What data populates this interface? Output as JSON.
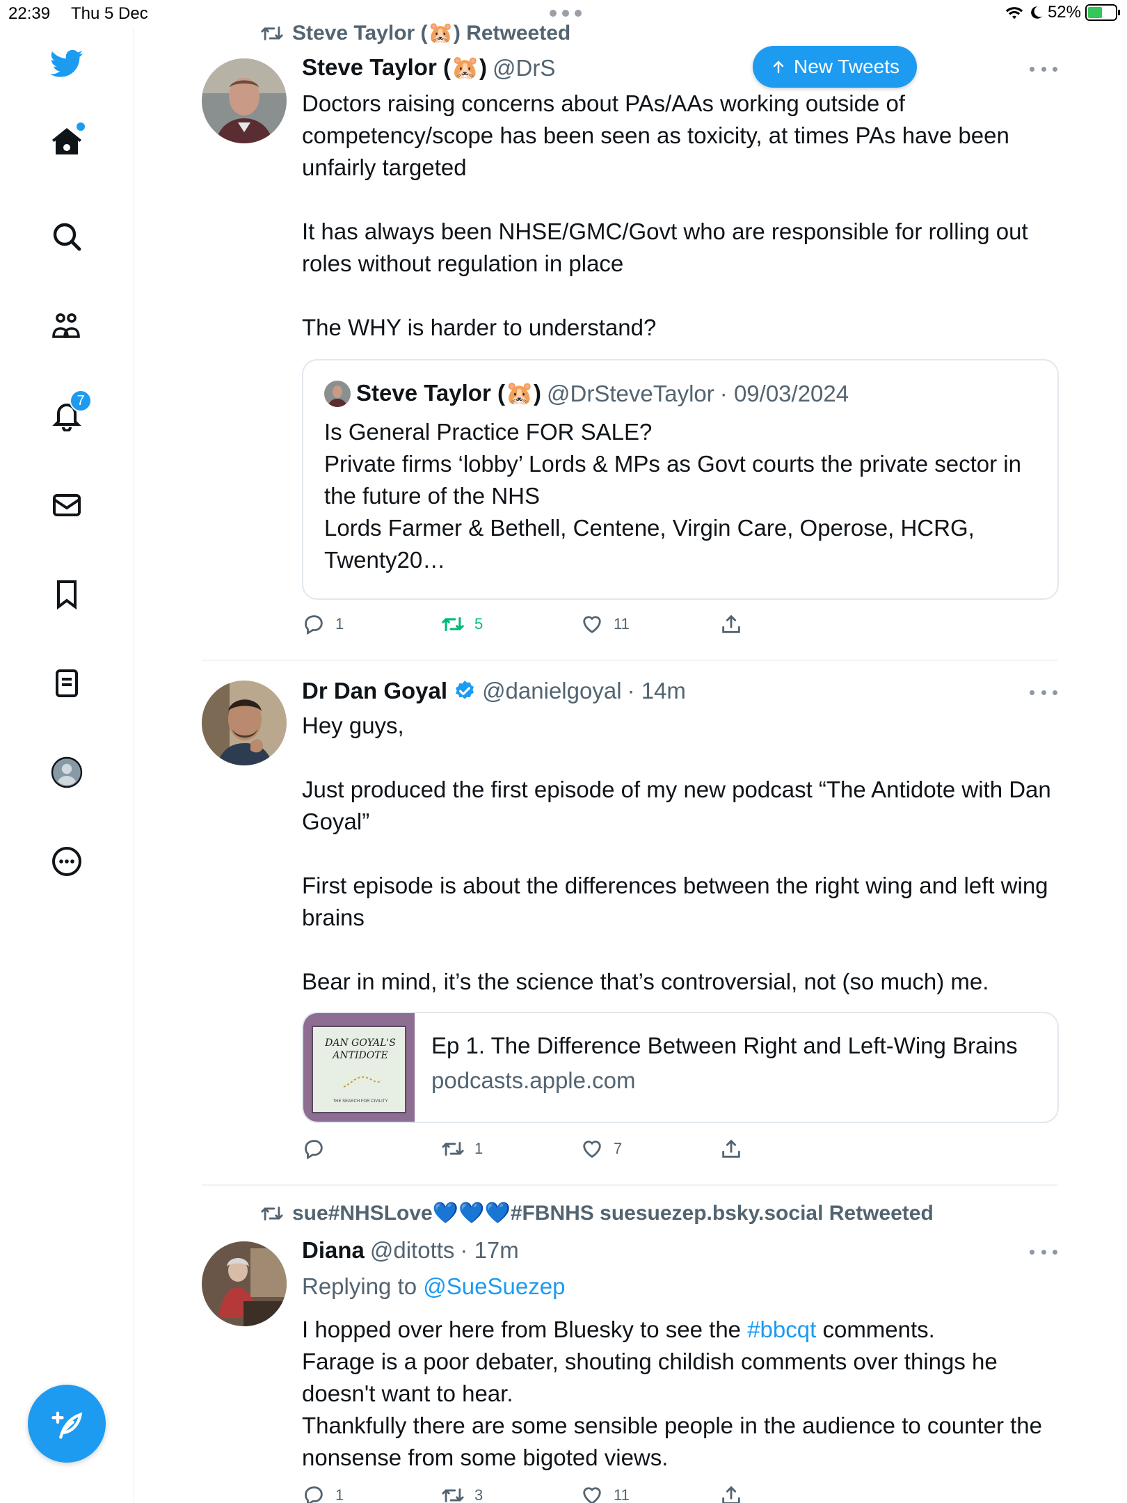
{
  "status_bar": {
    "time": "22:39",
    "date": "Thu 5 Dec",
    "battery": "52%",
    "battery_level": 0.52
  },
  "sidebar": {
    "notifications_count": "7"
  },
  "new_tweets_label": "New Tweets",
  "tweets": [
    {
      "retweeted_by": "Steve Taylor (🐹) Retweeted",
      "name": "Steve Taylor (🐹)",
      "handle": "@DrS",
      "body": [
        "Doctors raising concerns about PAs/AAs working outside of competency/scope has been seen as toxicity, at times PAs have been unfairly targeted",
        "",
        "It has always been NHSE/GMC/Govt who are responsible for rolling out roles without regulation in place",
        "",
        "The WHY is harder to understand?"
      ],
      "quote": {
        "name": "Steve Taylor (🐹)",
        "handle": "@DrSteveTaylor",
        "date": "· 09/03/2024",
        "body": [
          "Is General Practice FOR SALE?",
          "Private firms ‘lobby’ Lords & MPs as Govt courts the private sector in the future of the NHS",
          "Lords Farmer & Bethell, Centene, Virgin Care, Operose, HCRG, Twenty20…"
        ]
      },
      "replies": "1",
      "retweets": "5",
      "likes": "11"
    },
    {
      "name": "Dr Dan Goyal",
      "handle": "@danielgoyal",
      "time": "· 14m",
      "body": [
        "Hey guys,",
        "",
        "Just produced the first episode of my new podcast “The Antidote with Dan Goyal”",
        "",
        "First episode is about the differences between the right wing and left wing brains",
        "",
        "Bear in mind, it’s the science that’s controversial, not (so much) me."
      ],
      "card": {
        "thumb_text": "DAN GOYAL'S ANTIDOTE",
        "thumb_sub": "THE SEARCH FOR CIVILITY",
        "title": "Ep 1. The Difference Between Right and Left-Wing Brains",
        "domain": "podcasts.apple.com"
      },
      "replies": "",
      "retweets": "1",
      "likes": "7"
    },
    {
      "retweeted_by": "sue#NHSLove💙💙💙#FBNHS suesuezep.bsky.social Retweeted",
      "name": "Diana",
      "handle": "@ditotts",
      "time": "· 17m",
      "replying_label": "Replying to",
      "replying_to": "@SueSuezep",
      "body_pre": "I hopped over here from Bluesky to see the ",
      "body_tag": "#bbcqt",
      "body_post": " comments.",
      "body_rest": [
        "Farage is a poor debater, shouting childish comments over things he doesn't want to hear.",
        "Thankfully there are some sensible people in the audience to counter the nonsense from some bigoted views."
      ],
      "replies": "1",
      "retweets": "3",
      "likes": "11"
    }
  ]
}
